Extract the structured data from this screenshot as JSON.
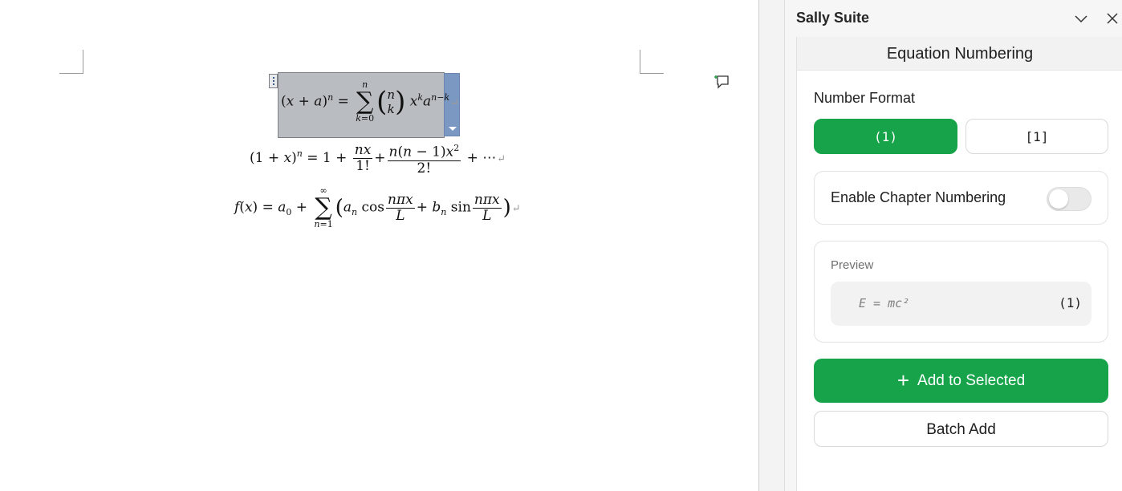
{
  "panel": {
    "title": "Sally Suite",
    "heading": "Equation Numbering",
    "number_format_label": "Number Format",
    "formats": [
      {
        "label": "(1)",
        "selected": true
      },
      {
        "label": "[1]",
        "selected": false
      }
    ],
    "chapter_numbering": {
      "label": "Enable Chapter Numbering",
      "enabled": false
    },
    "preview": {
      "label": "Preview",
      "equation": "E = mc²",
      "number": "(1)"
    },
    "add_button_label": "Add to Selected",
    "batch_button_label": "Batch Add"
  },
  "colors": {
    "accent": "#16a34a",
    "selection": "#b9bdc1",
    "dropdown": "#7b98c2"
  }
}
